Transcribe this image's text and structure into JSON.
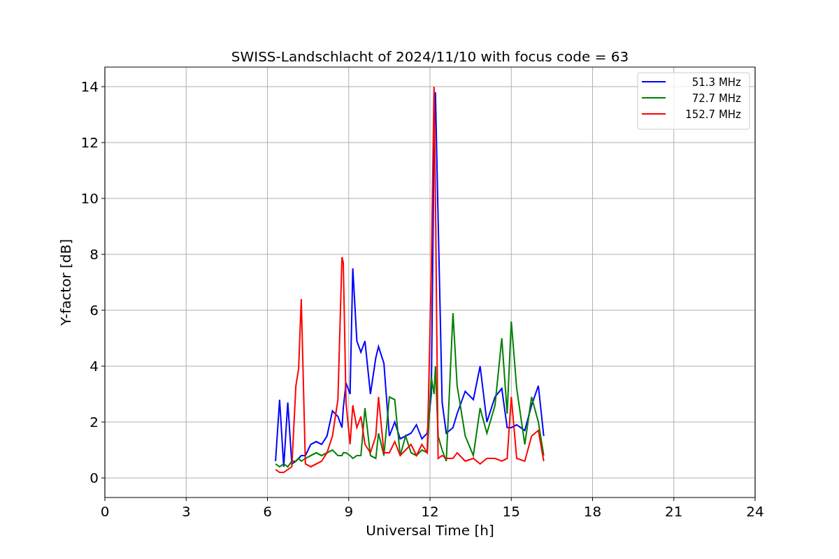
{
  "chart": {
    "chart_data": {
      "type": "line",
      "title": "SWISS-Landschlacht of 2024/11/10 with focus code = 63",
      "xlabel": "Universal Time [h]",
      "ylabel": "Y-factor [dB]",
      "x": [
        6.3,
        6.45,
        6.6,
        6.75,
        6.9,
        7.05,
        7.15,
        7.25,
        7.4,
        7.6,
        7.8,
        8.0,
        8.2,
        8.4,
        8.6,
        8.75,
        8.8,
        8.9,
        9.05,
        9.15,
        9.3,
        9.45,
        9.6,
        9.8,
        10.0,
        10.1,
        10.3,
        10.5,
        10.7,
        10.9,
        11.1,
        11.3,
        11.5,
        11.7,
        11.9,
        12.05,
        12.15,
        12.2,
        12.3,
        12.45,
        12.6,
        12.85,
        13.0,
        13.3,
        13.6,
        13.85,
        14.1,
        14.4,
        14.65,
        14.85,
        15.0,
        15.2,
        15.5,
        15.75,
        16.0,
        16.2
      ],
      "series": [
        {
          "name": "51.3 MHz",
          "color": "#0000ff",
          "values": [
            0.6,
            2.8,
            0.4,
            2.7,
            0.5,
            0.6,
            0.7,
            0.8,
            0.8,
            1.2,
            1.3,
            1.2,
            1.5,
            2.4,
            2.2,
            1.8,
            2.5,
            3.4,
            3.0,
            7.5,
            4.9,
            4.5,
            4.9,
            3.0,
            4.3,
            4.7,
            4.1,
            1.5,
            2.0,
            1.4,
            1.5,
            1.6,
            1.9,
            1.4,
            1.6,
            3.0,
            12.0,
            13.8,
            9.3,
            2.7,
            1.6,
            1.8,
            2.3,
            3.1,
            2.8,
            4.0,
            2.0,
            2.9,
            3.2,
            1.8,
            1.8,
            1.9,
            1.7,
            2.6,
            3.3,
            1.5
          ]
        },
        {
          "name": "72.7 MHz",
          "color": "#008000",
          "values": [
            0.5,
            0.4,
            0.5,
            0.4,
            0.6,
            0.6,
            0.7,
            0.6,
            0.7,
            0.8,
            0.9,
            0.8,
            0.9,
            1.0,
            0.8,
            0.8,
            0.9,
            0.9,
            0.8,
            0.7,
            0.8,
            0.8,
            2.5,
            0.8,
            0.7,
            1.6,
            0.8,
            2.9,
            2.8,
            0.8,
            1.5,
            0.9,
            0.8,
            1.0,
            0.9,
            3.6,
            3.0,
            4.0,
            1.5,
            1.0,
            0.6,
            5.9,
            3.3,
            1.5,
            0.8,
            2.5,
            1.6,
            2.6,
            5.0,
            2.3,
            5.6,
            3.2,
            1.2,
            2.9,
            2.0,
            0.8
          ]
        },
        {
          "name": "152.7 MHz",
          "color": "#ff0000",
          "values": [
            0.3,
            0.2,
            0.2,
            0.3,
            0.4,
            3.3,
            3.9,
            6.4,
            0.5,
            0.4,
            0.5,
            0.6,
            0.9,
            1.5,
            2.8,
            7.9,
            7.7,
            2.7,
            1.2,
            2.6,
            1.8,
            2.2,
            1.2,
            0.9,
            1.5,
            2.9,
            0.9,
            0.9,
            1.3,
            0.8,
            1.0,
            1.2,
            0.8,
            1.2,
            0.9,
            7.4,
            14.0,
            10.0,
            0.7,
            0.8,
            0.7,
            0.7,
            0.9,
            0.6,
            0.7,
            0.5,
            0.7,
            0.7,
            0.6,
            0.7,
            2.9,
            0.7,
            0.6,
            1.5,
            1.7,
            0.6
          ]
        }
      ],
      "grid": true,
      "xlim": [
        0,
        24
      ],
      "ylim": [
        -0.7,
        14.7
      ],
      "xticks": [
        0,
        3,
        6,
        9,
        12,
        15,
        18,
        21,
        24
      ],
      "yticks": [
        0,
        2,
        4,
        6,
        8,
        10,
        12,
        14
      ]
    }
  }
}
